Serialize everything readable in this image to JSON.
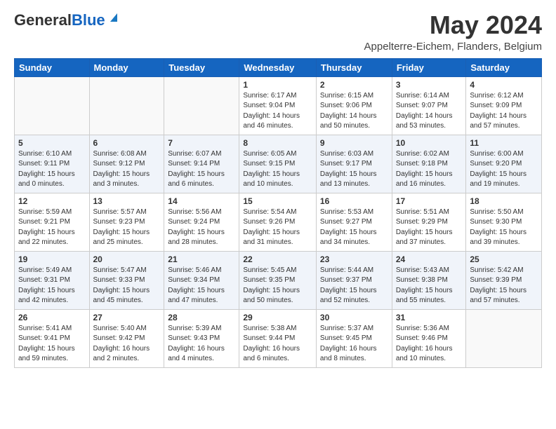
{
  "logo": {
    "general": "General",
    "blue": "Blue"
  },
  "title": "May 2024",
  "location": "Appelterre-Eichem, Flanders, Belgium",
  "weekdays": [
    "Sunday",
    "Monday",
    "Tuesday",
    "Wednesday",
    "Thursday",
    "Friday",
    "Saturday"
  ],
  "weeks": [
    [
      {
        "day": "",
        "detail": ""
      },
      {
        "day": "",
        "detail": ""
      },
      {
        "day": "",
        "detail": ""
      },
      {
        "day": "1",
        "detail": "Sunrise: 6:17 AM\nSunset: 9:04 PM\nDaylight: 14 hours\nand 46 minutes."
      },
      {
        "day": "2",
        "detail": "Sunrise: 6:15 AM\nSunset: 9:06 PM\nDaylight: 14 hours\nand 50 minutes."
      },
      {
        "day": "3",
        "detail": "Sunrise: 6:14 AM\nSunset: 9:07 PM\nDaylight: 14 hours\nand 53 minutes."
      },
      {
        "day": "4",
        "detail": "Sunrise: 6:12 AM\nSunset: 9:09 PM\nDaylight: 14 hours\nand 57 minutes."
      }
    ],
    [
      {
        "day": "5",
        "detail": "Sunrise: 6:10 AM\nSunset: 9:11 PM\nDaylight: 15 hours\nand 0 minutes."
      },
      {
        "day": "6",
        "detail": "Sunrise: 6:08 AM\nSunset: 9:12 PM\nDaylight: 15 hours\nand 3 minutes."
      },
      {
        "day": "7",
        "detail": "Sunrise: 6:07 AM\nSunset: 9:14 PM\nDaylight: 15 hours\nand 6 minutes."
      },
      {
        "day": "8",
        "detail": "Sunrise: 6:05 AM\nSunset: 9:15 PM\nDaylight: 15 hours\nand 10 minutes."
      },
      {
        "day": "9",
        "detail": "Sunrise: 6:03 AM\nSunset: 9:17 PM\nDaylight: 15 hours\nand 13 minutes."
      },
      {
        "day": "10",
        "detail": "Sunrise: 6:02 AM\nSunset: 9:18 PM\nDaylight: 15 hours\nand 16 minutes."
      },
      {
        "day": "11",
        "detail": "Sunrise: 6:00 AM\nSunset: 9:20 PM\nDaylight: 15 hours\nand 19 minutes."
      }
    ],
    [
      {
        "day": "12",
        "detail": "Sunrise: 5:59 AM\nSunset: 9:21 PM\nDaylight: 15 hours\nand 22 minutes."
      },
      {
        "day": "13",
        "detail": "Sunrise: 5:57 AM\nSunset: 9:23 PM\nDaylight: 15 hours\nand 25 minutes."
      },
      {
        "day": "14",
        "detail": "Sunrise: 5:56 AM\nSunset: 9:24 PM\nDaylight: 15 hours\nand 28 minutes."
      },
      {
        "day": "15",
        "detail": "Sunrise: 5:54 AM\nSunset: 9:26 PM\nDaylight: 15 hours\nand 31 minutes."
      },
      {
        "day": "16",
        "detail": "Sunrise: 5:53 AM\nSunset: 9:27 PM\nDaylight: 15 hours\nand 34 minutes."
      },
      {
        "day": "17",
        "detail": "Sunrise: 5:51 AM\nSunset: 9:29 PM\nDaylight: 15 hours\nand 37 minutes."
      },
      {
        "day": "18",
        "detail": "Sunrise: 5:50 AM\nSunset: 9:30 PM\nDaylight: 15 hours\nand 39 minutes."
      }
    ],
    [
      {
        "day": "19",
        "detail": "Sunrise: 5:49 AM\nSunset: 9:31 PM\nDaylight: 15 hours\nand 42 minutes."
      },
      {
        "day": "20",
        "detail": "Sunrise: 5:47 AM\nSunset: 9:33 PM\nDaylight: 15 hours\nand 45 minutes."
      },
      {
        "day": "21",
        "detail": "Sunrise: 5:46 AM\nSunset: 9:34 PM\nDaylight: 15 hours\nand 47 minutes."
      },
      {
        "day": "22",
        "detail": "Sunrise: 5:45 AM\nSunset: 9:35 PM\nDaylight: 15 hours\nand 50 minutes."
      },
      {
        "day": "23",
        "detail": "Sunrise: 5:44 AM\nSunset: 9:37 PM\nDaylight: 15 hours\nand 52 minutes."
      },
      {
        "day": "24",
        "detail": "Sunrise: 5:43 AM\nSunset: 9:38 PM\nDaylight: 15 hours\nand 55 minutes."
      },
      {
        "day": "25",
        "detail": "Sunrise: 5:42 AM\nSunset: 9:39 PM\nDaylight: 15 hours\nand 57 minutes."
      }
    ],
    [
      {
        "day": "26",
        "detail": "Sunrise: 5:41 AM\nSunset: 9:41 PM\nDaylight: 15 hours\nand 59 minutes."
      },
      {
        "day": "27",
        "detail": "Sunrise: 5:40 AM\nSunset: 9:42 PM\nDaylight: 16 hours\nand 2 minutes."
      },
      {
        "day": "28",
        "detail": "Sunrise: 5:39 AM\nSunset: 9:43 PM\nDaylight: 16 hours\nand 4 minutes."
      },
      {
        "day": "29",
        "detail": "Sunrise: 5:38 AM\nSunset: 9:44 PM\nDaylight: 16 hours\nand 6 minutes."
      },
      {
        "day": "30",
        "detail": "Sunrise: 5:37 AM\nSunset: 9:45 PM\nDaylight: 16 hours\nand 8 minutes."
      },
      {
        "day": "31",
        "detail": "Sunrise: 5:36 AM\nSunset: 9:46 PM\nDaylight: 16 hours\nand 10 minutes."
      },
      {
        "day": "",
        "detail": ""
      }
    ]
  ]
}
